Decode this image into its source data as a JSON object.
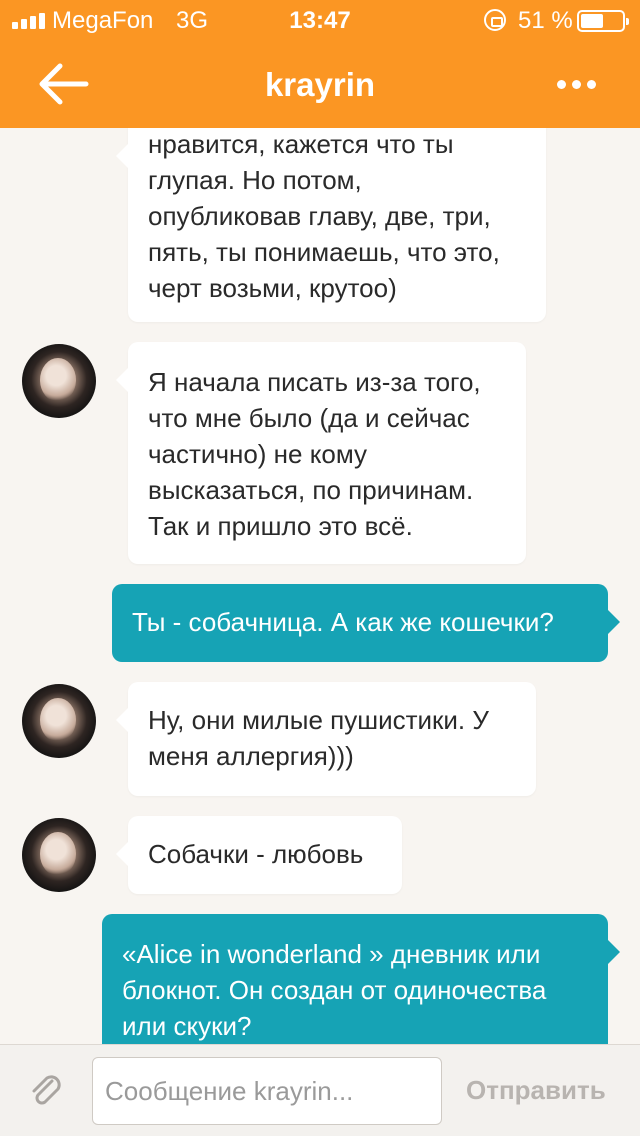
{
  "status_bar": {
    "carrier": "MegaFon",
    "network": "3G",
    "time": "13:47",
    "battery_percent": "51 %"
  },
  "header": {
    "title": "krayrin"
  },
  "messages": [
    {
      "direction": "incoming",
      "lines": [
        "нравится, кажется что ты",
        "глупая. Но потом,",
        "опубликовав главу, две, три,",
        "пять, ты понимаешь, что это,",
        "черт возьми, крутоо)"
      ]
    },
    {
      "direction": "incoming",
      "lines": [
        "Я начала писать из-за того,",
        "что мне было (да и сейчас",
        "частично) не кому",
        "высказаться, по причинам.",
        "Так и пришло это всё."
      ]
    },
    {
      "direction": "outgoing",
      "lines": [
        "Ты - собачница. А как же кошечки?"
      ]
    },
    {
      "direction": "incoming",
      "lines": [
        "Ну, они милые пушистики. У",
        "меня аллергия)))"
      ]
    },
    {
      "direction": "incoming",
      "lines": [
        "Собачки - любовь"
      ]
    },
    {
      "direction": "outgoing",
      "lines": [
        "«Alice in wonderland » дневник или",
        "блокнот. Он создан от одиночества",
        "или скуки?"
      ]
    }
  ],
  "composer": {
    "placeholder": "Сообщение krayrin...",
    "send_label": "Отправить"
  },
  "colors": {
    "header": "#fb9623",
    "outgoing_bubble": "#16a3b5",
    "incoming_bubble": "#ffffff",
    "background": "#f8f5f1"
  }
}
